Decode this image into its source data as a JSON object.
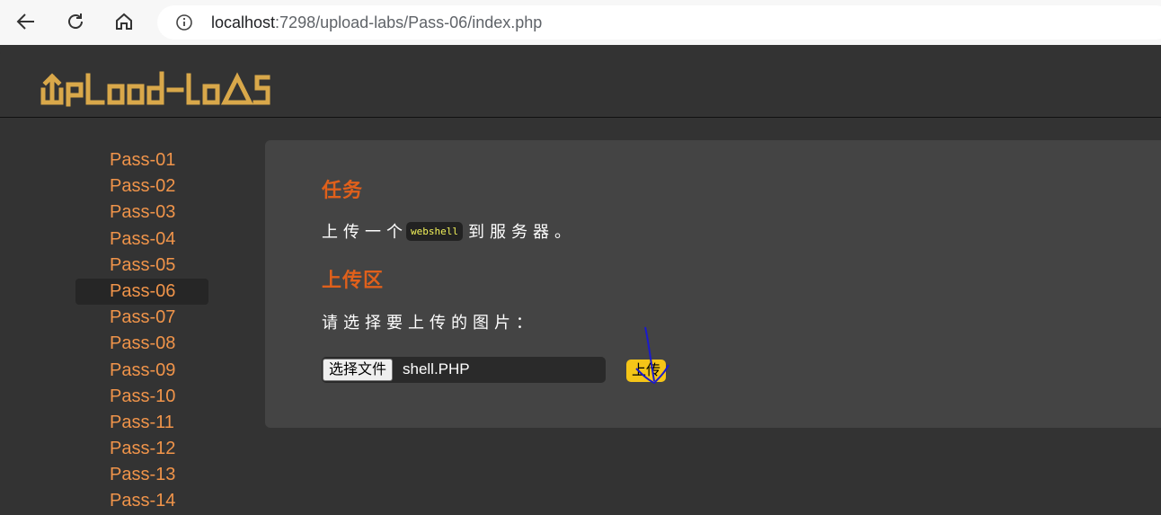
{
  "browser": {
    "url_host": "localhost",
    "url_rest": ":7298/upload-labs/Pass-06/index.php"
  },
  "header": {
    "logo_text": "UpLoad-labS"
  },
  "sidebar": {
    "items": [
      {
        "label": "Pass-01"
      },
      {
        "label": "Pass-02"
      },
      {
        "label": "Pass-03"
      },
      {
        "label": "Pass-04"
      },
      {
        "label": "Pass-05"
      },
      {
        "label": "Pass-06"
      },
      {
        "label": "Pass-07"
      },
      {
        "label": "Pass-08"
      },
      {
        "label": "Pass-09"
      },
      {
        "label": "Pass-10"
      },
      {
        "label": "Pass-11"
      },
      {
        "label": "Pass-12"
      },
      {
        "label": "Pass-13"
      },
      {
        "label": "Pass-14"
      }
    ],
    "active": "Pass-06"
  },
  "main": {
    "task_title": "任务",
    "task_prefix": "上传一个",
    "task_code": "webshell",
    "task_suffix": "到服务器。",
    "upload_title": "上传区",
    "select_label": "请选择要上传的图片：",
    "file_button": "选择文件",
    "file_name": "shell.PHP",
    "upload_button": "上传"
  },
  "colors": {
    "accent_orange": "#e0601b",
    "sidebar_link": "#f0944a",
    "logo_gold": "#d9a84a",
    "upload_yellow": "#f5c518",
    "annotation_blue": "#1a1acc"
  }
}
